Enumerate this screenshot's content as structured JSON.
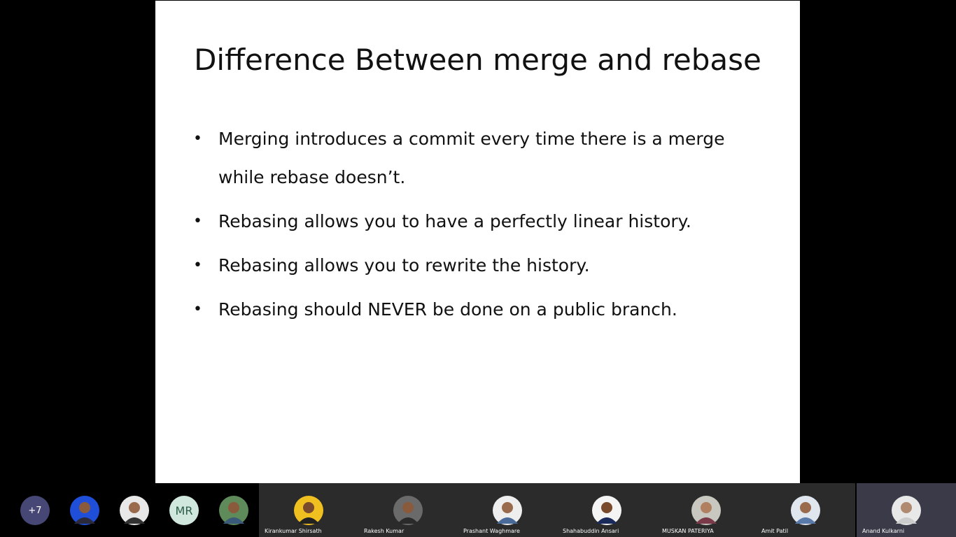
{
  "slide": {
    "title": "Difference Between merge and rebase",
    "bullets": [
      "Merging introduces a commit every time there is a merge while rebase doesn’t.",
      "Rebasing allows you to have a perfectly linear history.",
      "Rebasing allows you to rewrite the history.",
      "Rebasing should NEVER be done on a public branch."
    ]
  },
  "participants": {
    "overflow_label": "+7",
    "initials_avatar": "MR",
    "tiles": [
      {
        "name": "Kirankumar Shirsath"
      },
      {
        "name": "Rakesh Kumar"
      },
      {
        "name": "Prashant Waghmare"
      },
      {
        "name": "Shahabuddin Ansari"
      },
      {
        "name": "MUSKAN PATERIYA"
      },
      {
        "name": "Amit Patil"
      },
      {
        "name": "Anand Kulkarni"
      }
    ]
  },
  "colors": {
    "background": "#000000",
    "slide": "#ffffff",
    "overflow_badge": "#464775",
    "initials_bg": "#cfe7dc",
    "tile_bg": "#2b2b2b",
    "tile_active_bg": "#3a3a48"
  },
  "icons": [
    "avatar-photo-icon"
  ]
}
